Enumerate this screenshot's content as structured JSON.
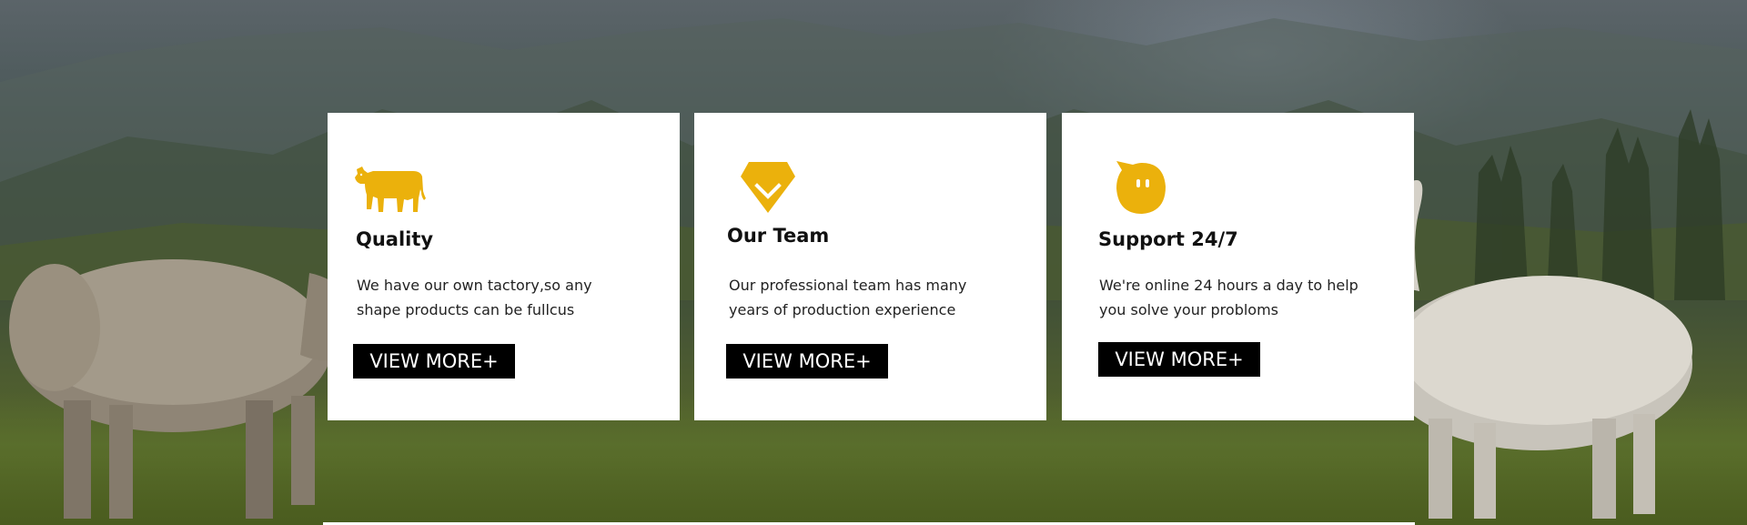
{
  "colors": {
    "accent": "#EBB10C",
    "card_background": "#FFFFFF",
    "button_background": "#000000",
    "button_text": "#FFFFFF"
  },
  "features": [
    {
      "icon": "cow-icon",
      "title": "Quality",
      "text_lines": [
        "We have our own tactory,so any",
        "shape products can be fullcus"
      ],
      "button_label": "VIEW MORE+"
    },
    {
      "icon": "diamond-check-icon",
      "title": "Our Team",
      "text_lines": [
        "Our professional team has many",
        "years of production experience"
      ],
      "button_label": "VIEW MORE+"
    },
    {
      "icon": "chat-bubble-icon",
      "title": "Support 24/7",
      "text_lines": [
        "We're online 24 hours a day to help",
        "you solve your probloms"
      ],
      "button_label": "VIEW MORE+"
    }
  ]
}
